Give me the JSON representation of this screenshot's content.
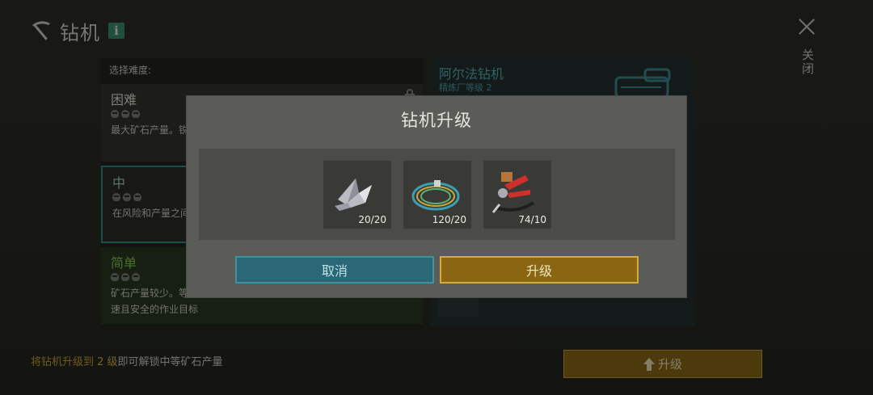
{
  "header": {
    "title": "钻机",
    "info_badge": "i",
    "close_label": "关闭"
  },
  "difficulty": {
    "heading": "选择难度:",
    "options": [
      {
        "name": "困难",
        "description": "最大矿石产量。锐",
        "locked": true
      },
      {
        "name": "中",
        "description": "在风险和产量之间",
        "selected": true
      },
      {
        "name": "简单",
        "description_line1": "矿石产量较少。等",
        "description_line2": "速且安全的作业目标"
      }
    ]
  },
  "drill": {
    "name": "阿尔法钻机",
    "subtitle": "精炼厂等级 2"
  },
  "footer": {
    "hint_prefix": "将钻机升级到 ",
    "hint_level": "2 级",
    "hint_suffix": "即可解锁中等矿石产量",
    "upgrade_label": "升级"
  },
  "modal": {
    "title": "钻机升级",
    "requirements": [
      {
        "item": "metal-parts-icon",
        "count": "20/20"
      },
      {
        "item": "wires-icon",
        "count": "120/20"
      },
      {
        "item": "tools-icon",
        "count": "74/10"
      }
    ],
    "cancel_label": "取消",
    "confirm_label": "升级"
  },
  "colors": {
    "accent_teal": "#3f93a1",
    "accent_gold": "#d4ab3c",
    "easy_green": "#89c64b",
    "hint_gold": "#c9a338"
  }
}
